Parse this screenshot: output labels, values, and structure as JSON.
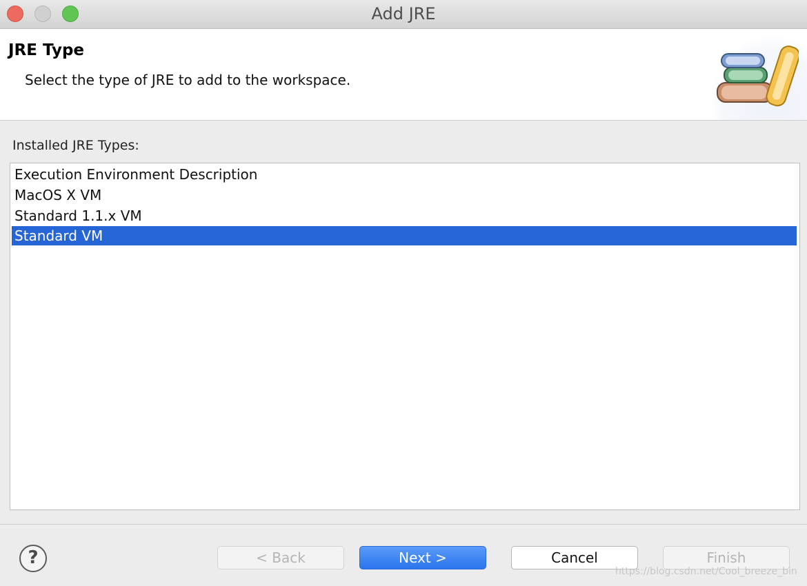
{
  "window": {
    "title": "Add JRE",
    "controls": [
      "close",
      "minimize",
      "zoom"
    ]
  },
  "header": {
    "title": "JRE Type",
    "description": "Select the type of JRE to add to the workspace.",
    "icon": "jre-books-icon"
  },
  "list": {
    "label": "Installed JRE Types:",
    "items": [
      {
        "label": "Execution Environment Description",
        "selected": false
      },
      {
        "label": "MacOS X VM",
        "selected": false
      },
      {
        "label": "Standard 1.1.x VM",
        "selected": false
      },
      {
        "label": "Standard VM",
        "selected": true
      }
    ],
    "selection_color": "#2665d6"
  },
  "footer": {
    "help_symbol": "?",
    "buttons": {
      "back": {
        "label": "< Back",
        "enabled": false
      },
      "next": {
        "label": "Next >",
        "enabled": true,
        "default": true
      },
      "cancel": {
        "label": "Cancel",
        "enabled": true
      },
      "finish": {
        "label": "Finish",
        "enabled": false
      }
    }
  },
  "watermark": "https://blog.csdn.net/Cool_breeze_bin"
}
